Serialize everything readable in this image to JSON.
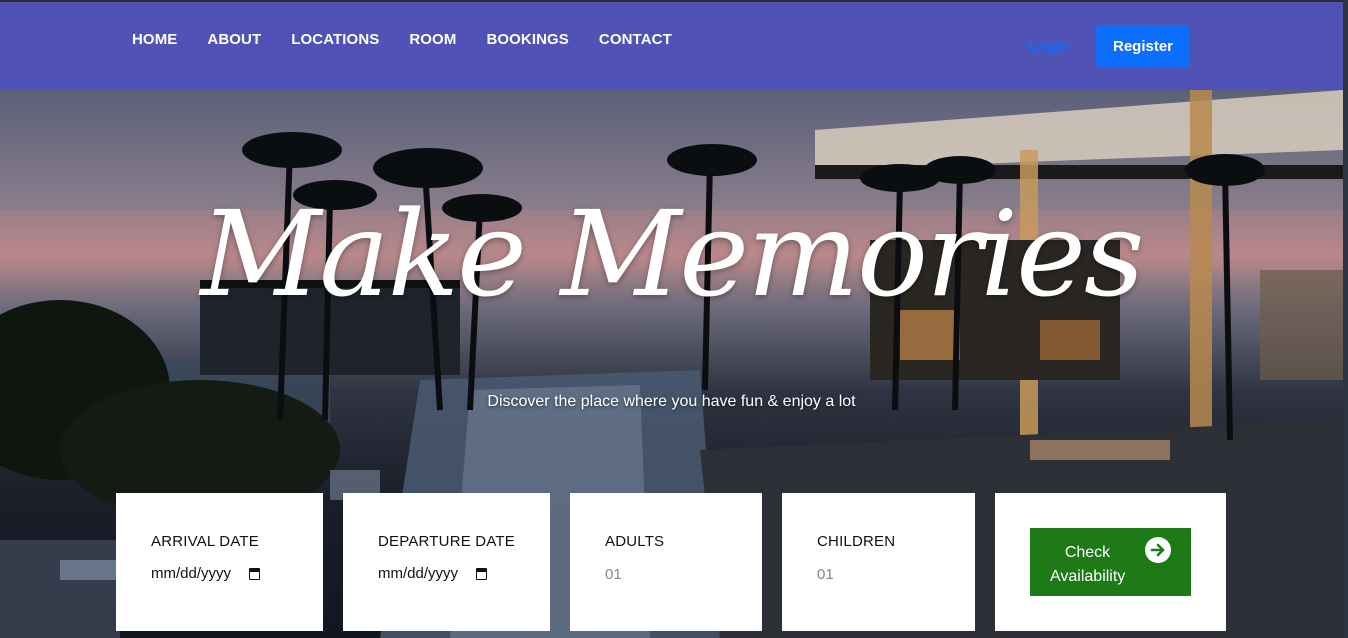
{
  "nav": {
    "links": [
      "HOME",
      "ABOUT",
      "LOCATIONS",
      "ROOM",
      "BOOKINGS",
      "CONTACT"
    ],
    "login": "Login",
    "register": "Register"
  },
  "hero": {
    "title": "Make Memories",
    "subtitle": "Discover the place where you have fun & enjoy a lot"
  },
  "booking": {
    "arrival_label": "ARRIVAL DATE",
    "arrival_value": "mm/dd/yyyy",
    "departure_label": "DEPARTURE DATE",
    "departure_value": "mm/dd/yyyy",
    "adults_label": "ADULTS",
    "adults_value": "01",
    "children_label": "CHILDREN",
    "children_value": "01",
    "check_label": "Check Availability"
  },
  "colors": {
    "navbar": "#5052b5",
    "primary": "#0d6efd",
    "check_button": "#1e7a16"
  }
}
